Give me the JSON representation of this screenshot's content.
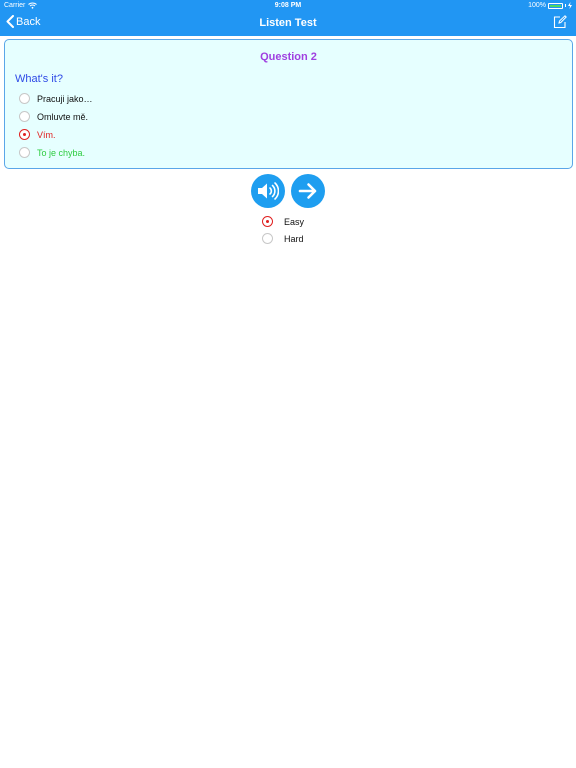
{
  "status_bar": {
    "carrier": "Carrier",
    "time": "9:08 PM",
    "battery": "100%",
    "battery_level": 1.0
  },
  "nav": {
    "back_label": "Back",
    "title": "Listen Test"
  },
  "question": {
    "title": "Question 2",
    "prompt": "What's it?",
    "options": [
      {
        "text": "Pracuji jako…",
        "selected": false,
        "color": "#111111"
      },
      {
        "text": "Omluvte mě.",
        "selected": false,
        "color": "#111111"
      },
      {
        "text": "Vím.",
        "selected": true,
        "color": "#e02020"
      },
      {
        "text": "To je chyba.",
        "selected": false,
        "color": "#2ecc40"
      }
    ]
  },
  "difficulty": {
    "options": [
      {
        "text": "Easy",
        "selected": true
      },
      {
        "text": "Hard",
        "selected": false
      }
    ]
  },
  "colors": {
    "accent": "#2196f3",
    "card_bg": "#e6ffff",
    "title": "#a040e0",
    "prompt": "#2f4ae6"
  }
}
